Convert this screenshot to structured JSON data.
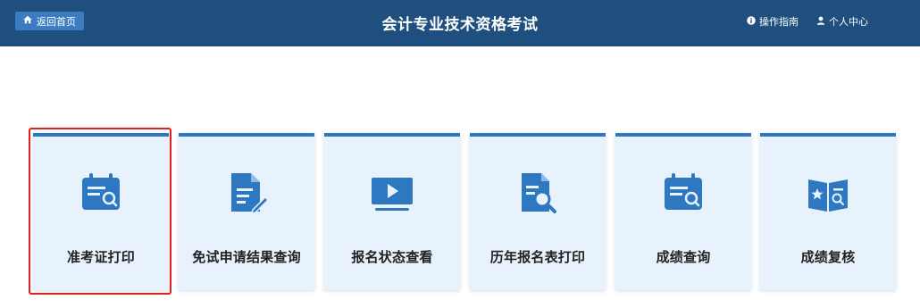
{
  "header": {
    "back_label": "返回首页",
    "back_icon": "home-icon",
    "title": "会计专业技术资格考试",
    "guide_label": "操作指南",
    "guide_icon": "info-icon",
    "user_label": "个人中心",
    "user_icon": "user-icon"
  },
  "cards": [
    {
      "label": "准考证打印",
      "icon": "calendar-search-icon",
      "selected": true
    },
    {
      "label": "免试申请结果查询",
      "icon": "document-edit-icon",
      "selected": false
    },
    {
      "label": "报名状态查看",
      "icon": "monitor-play-icon",
      "selected": false
    },
    {
      "label": "历年报名表打印",
      "icon": "document-search-icon",
      "selected": false
    },
    {
      "label": "成绩查询",
      "icon": "calendar-search-icon",
      "selected": false
    },
    {
      "label": "成绩复核",
      "icon": "book-star-search-icon",
      "selected": false
    }
  ],
  "colors": {
    "header_bg": "#1e4f7f",
    "accent": "#2e78c2",
    "card_bg": "#e8f2fd",
    "selection": "#e02020"
  }
}
